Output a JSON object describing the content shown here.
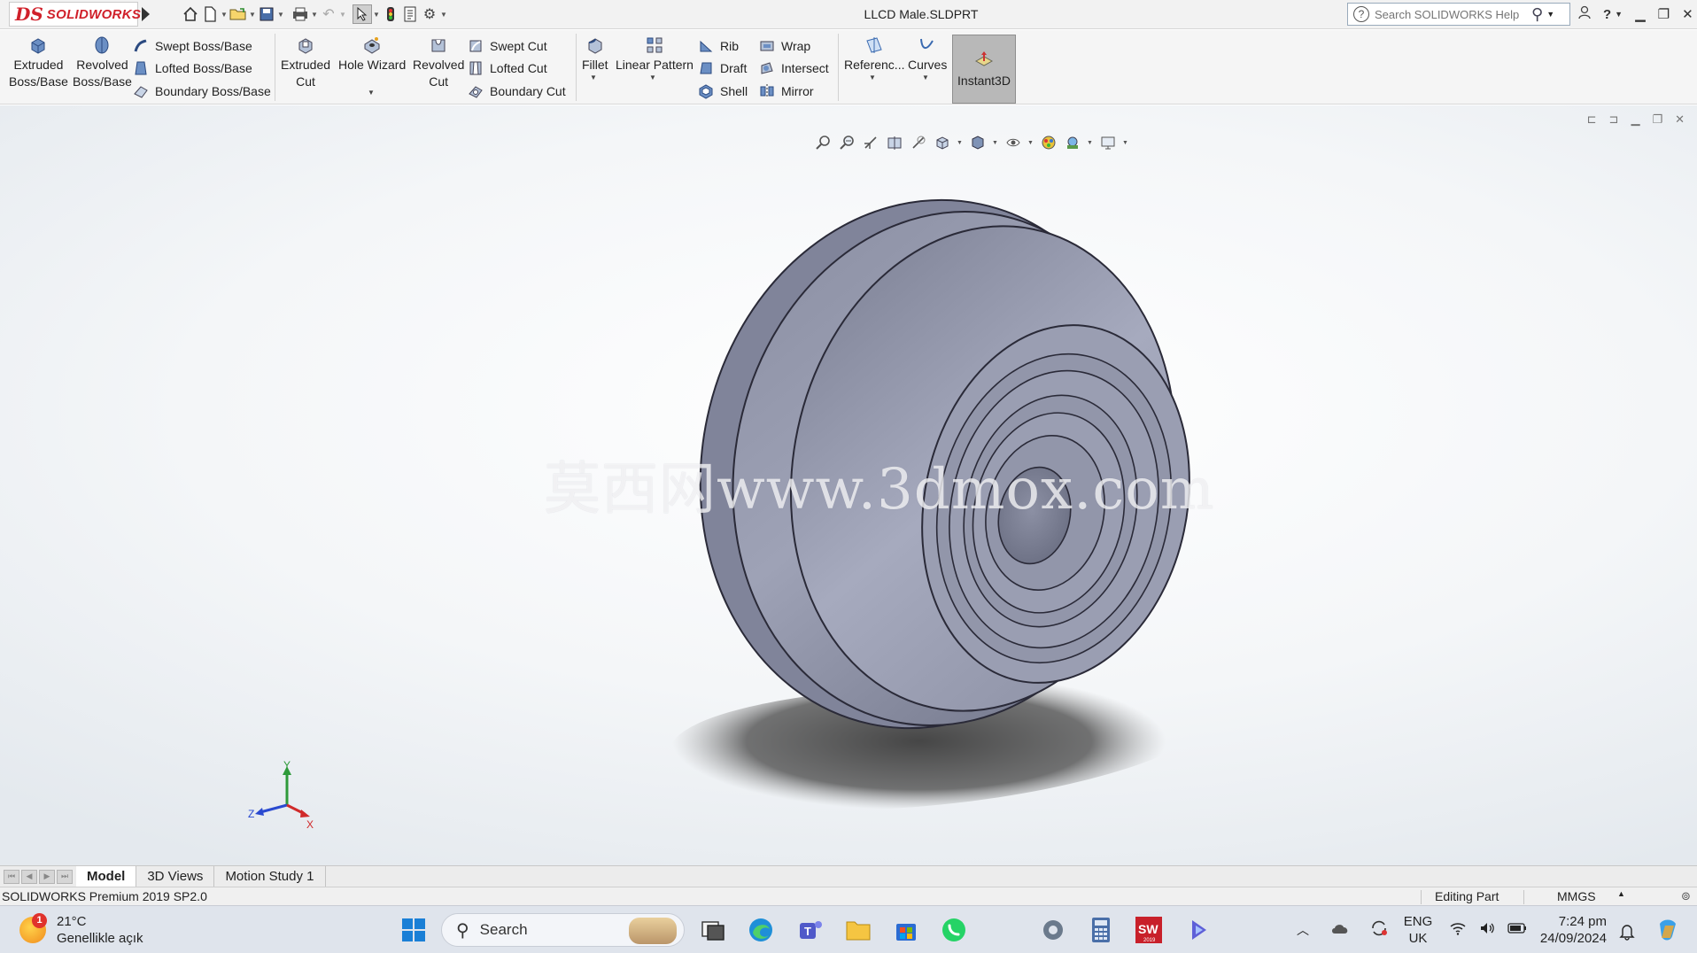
{
  "app": {
    "brand_ds": "DS",
    "brand_name": "SOLIDWORKS",
    "document_title": "LLCD Male.SLDPRT",
    "help_search_placeholder": "Search SOLIDWORKS Help"
  },
  "ribbon": {
    "extruded_boss": [
      "Extruded",
      "Boss/Base"
    ],
    "revolved_boss": [
      "Revolved",
      "Boss/Base"
    ],
    "swept_boss": "Swept Boss/Base",
    "lofted_boss": "Lofted Boss/Base",
    "boundary_boss": "Boundary Boss/Base",
    "extruded_cut": [
      "Extruded",
      "Cut"
    ],
    "hole_wizard": "Hole Wizard",
    "revolved_cut": [
      "Revolved",
      "Cut"
    ],
    "swept_cut": "Swept Cut",
    "lofted_cut": "Lofted Cut",
    "boundary_cut": "Boundary Cut",
    "fillet": "Fillet",
    "linear_pattern": "Linear Pattern",
    "rib": "Rib",
    "draft": "Draft",
    "shell": "Shell",
    "wrap": "Wrap",
    "intersect": "Intersect",
    "mirror": "Mirror",
    "reference": "Referenc...",
    "curves": "Curves",
    "instant3d": "Instant3D"
  },
  "viewport": {
    "watermark": "莫西网www.3dmox.com",
    "triad": {
      "x": "X",
      "y": "Y",
      "z": "Z"
    }
  },
  "tabs": [
    {
      "label": "Model",
      "active": true
    },
    {
      "label": "3D Views",
      "active": false
    },
    {
      "label": "Motion Study 1",
      "active": false
    }
  ],
  "status": {
    "product": "SOLIDWORKS Premium 2019 SP2.0",
    "mode": "Editing Part",
    "units": "MMGS"
  },
  "taskbar": {
    "weather_badge": "1",
    "temperature": "21°C",
    "weather_desc": "Genellikle açık",
    "search_label": "Search",
    "lang_top": "ENG",
    "lang_bottom": "UK",
    "time": "7:24 pm",
    "date": "24/09/2024",
    "sw_badge": "2019"
  },
  "colors": {
    "brand_red": "#d0202a",
    "part_body": "#8c90a4",
    "part_edge": "#2a2a38"
  }
}
